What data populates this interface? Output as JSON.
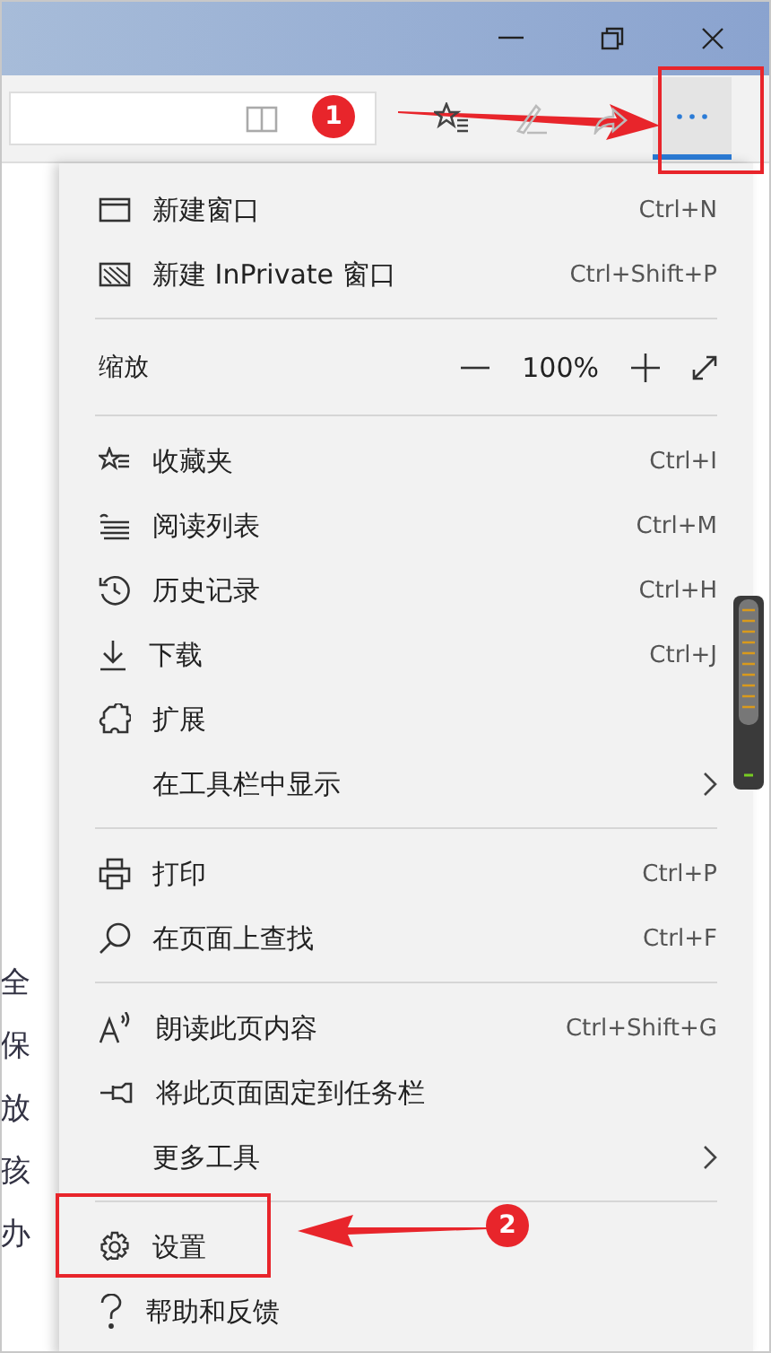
{
  "toolbar": {
    "more_button": {
      "selected": true
    }
  },
  "menu": {
    "sections": [
      {
        "items": [
          {
            "kind": "command",
            "label": "新建窗口",
            "shortcut": "Ctrl+N"
          },
          {
            "kind": "command",
            "label": "新建 InPrivate 窗口",
            "shortcut": "Ctrl+Shift+P"
          }
        ]
      },
      {
        "items": [
          {
            "kind": "zoom",
            "label": "缩放",
            "value": "100%"
          }
        ]
      },
      {
        "items": [
          {
            "kind": "command",
            "label": "收藏夹",
            "shortcut": "Ctrl+I"
          },
          {
            "kind": "command",
            "label": "阅读列表",
            "shortcut": "Ctrl+M"
          },
          {
            "kind": "command",
            "label": "历史记录",
            "shortcut": "Ctrl+H"
          },
          {
            "kind": "command",
            "label": "下载",
            "shortcut": "Ctrl+J"
          },
          {
            "kind": "command",
            "label": "扩展"
          },
          {
            "kind": "submenu",
            "label": "在工具栏中显示"
          }
        ]
      },
      {
        "items": [
          {
            "kind": "command",
            "label": "打印",
            "shortcut": "Ctrl+P"
          },
          {
            "kind": "command",
            "label": "在页面上查找",
            "shortcut": "Ctrl+F"
          }
        ]
      },
      {
        "items": [
          {
            "kind": "command",
            "label": "朗读此页内容",
            "shortcut": "Ctrl+Shift+G"
          },
          {
            "kind": "command",
            "label": "将此页面固定到任务栏"
          },
          {
            "kind": "submenu",
            "label": "更多工具"
          }
        ]
      },
      {
        "items": [
          {
            "kind": "command",
            "label": "设置"
          },
          {
            "kind": "command",
            "label": "帮助和反馈"
          }
        ]
      }
    ]
  },
  "page_fragments": [
    "全",
    "保",
    "放",
    "孩",
    "办"
  ],
  "annotations": [
    {
      "label": "1"
    },
    {
      "label": "2"
    }
  ]
}
